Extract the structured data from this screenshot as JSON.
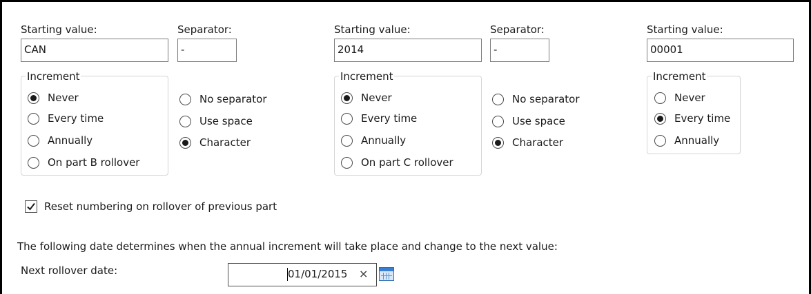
{
  "part_a": {
    "starting_label": "Starting value:",
    "starting_value": "CAN",
    "separator_label": "Separator:",
    "separator_value": "-",
    "increment_legend": "Increment",
    "increment_options": [
      "Never",
      "Every time",
      "Annually",
      "On part B rollover"
    ],
    "increment_selected": "Never",
    "separator_options": [
      "No separator",
      "Use space",
      "Character"
    ],
    "separator_selected": "Character"
  },
  "part_b": {
    "starting_label": "Starting value:",
    "starting_value": "2014",
    "separator_label": "Separator:",
    "separator_value": "-",
    "increment_legend": "Increment",
    "increment_options": [
      "Never",
      "Every time",
      "Annually",
      "On part C rollover"
    ],
    "increment_selected": "Never",
    "separator_options": [
      "No separator",
      "Use space",
      "Character"
    ],
    "separator_selected": "Character"
  },
  "part_c": {
    "starting_label": "Starting value:",
    "starting_value": "00001",
    "increment_legend": "Increment",
    "increment_options": [
      "Never",
      "Every time",
      "Annually"
    ],
    "increment_selected": "Every time"
  },
  "reset_checkbox": {
    "label": "Reset numbering on rollover of previous part",
    "checked": true
  },
  "rollover": {
    "description": "The following date determines when the annual increment will take place and change to the next value:",
    "date_label": "Next rollover date:",
    "date_value": "01/01/2015",
    "clear_glyph": "×",
    "calendar_icon": "calendar-icon"
  }
}
